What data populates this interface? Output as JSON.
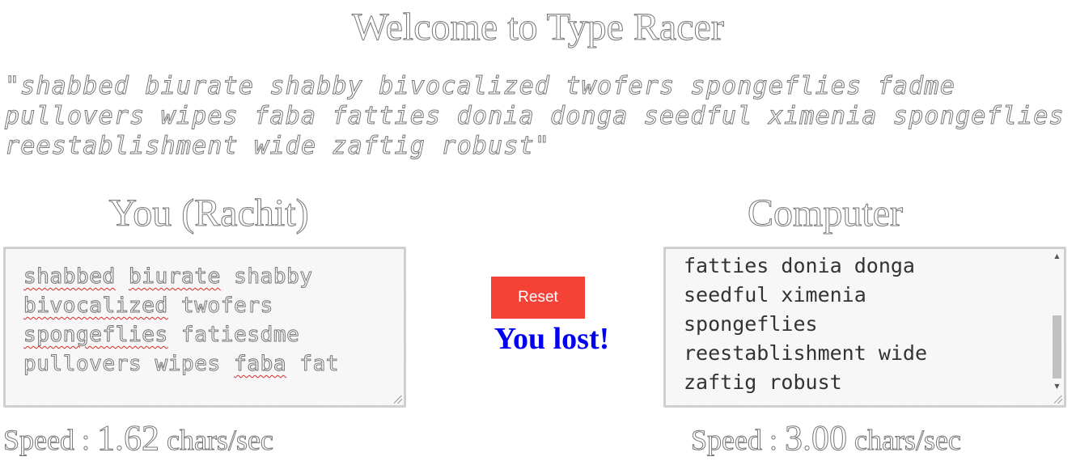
{
  "header": {
    "title": "Welcome to Type Racer"
  },
  "quote": {
    "text": "\"shabbed biurate shabby bivocalized twofers spongeflies fadme pullovers wipes faba fatties donia donga seedful ximenia spongeflies reestablishment wide zaftig robust\""
  },
  "user": {
    "heading": "You (Rachit)",
    "typed_lines": [
      [
        {
          "text": "shabbed",
          "misspelled": true
        },
        {
          "text": " "
        },
        {
          "text": "biurate",
          "misspelled": true
        },
        {
          "text": " shabby"
        }
      ],
      [
        {
          "text": "bivocalized",
          "misspelled": true
        },
        {
          "text": " twofers"
        }
      ],
      [
        {
          "text": "spongeflies",
          "misspelled": true
        },
        {
          "text": " fatiesdme"
        }
      ],
      [
        {
          "text": "pullovers wipes "
        },
        {
          "text": "faba",
          "misspelled": true
        },
        {
          "text": " fat"
        }
      ]
    ],
    "speed_label": "Speed : ",
    "speed_value": "1.62",
    "speed_unit": " chars/sec"
  },
  "computer": {
    "heading": "Computer",
    "typed_lines": [
      "fatties donia donga",
      "seedful ximenia",
      "spongeflies",
      "reestablishment wide",
      "zaftig robust"
    ],
    "speed_label": "Speed : ",
    "speed_value": "3.00",
    "speed_unit": " chars/sec"
  },
  "controls": {
    "reset_label": "Reset",
    "result_text": "You lost!"
  },
  "icons": {
    "scroll_up": "up-arrow-icon",
    "scroll_down": "down-arrow-icon",
    "resize": "resize-grip-icon"
  },
  "colors": {
    "reset_button": "#f44336",
    "result_text": "#0000ee",
    "spellcheck": "#e53935"
  }
}
